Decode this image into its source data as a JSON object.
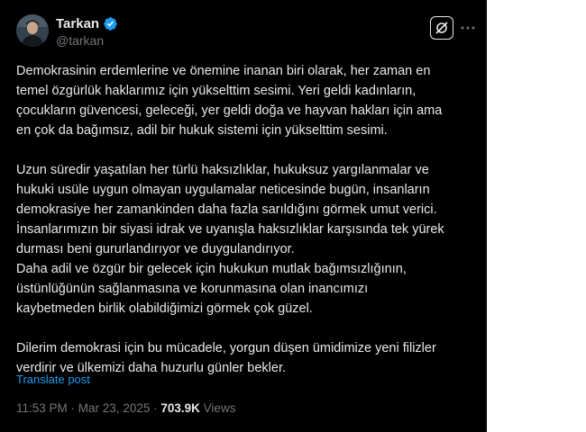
{
  "author": {
    "display_name": "Tarkan",
    "handle": "@tarkan",
    "verified": true,
    "verified_color": "#1d9bf0",
    "avatar_icon": "avatar-photo"
  },
  "actions": {
    "grok_icon": "grok-icon",
    "more_icon": "more-dots-icon"
  },
  "tweet": {
    "paragraphs": [
      {
        "lines": [
          "Demokrasinin erdemlerine ve önemine inanan biri olarak, her zaman en",
          "temel özgürlük haklarımız için yükselttim sesimi. Yeri geldi kadınların,",
          "çocukların güvencesi, geleceği, yer geldi doğa ve hayvan hakları için ama",
          "en çok da bağımsız, adil bir hukuk sistemi için  yükselttim sesimi."
        ]
      },
      {
        "lines": [
          "Uzun süredir yaşatılan her türlü haksızlıklar, hukuksuz yargılanmalar ve",
          "hukuki usüle uygun olmayan uygulamalar neticesinde bugün,  insanların",
          "demokrasiye her zamankinden daha fazla sarıldığını görmek umut verici.",
          "İnsanlarımızın bir siyasi idrak ve uyanışla haksızlıklar karşısında tek yürek",
          "durması beni gururlandırıyor ve duygulandırıyor.",
          "Daha adil ve özgür bir gelecek için hukukun mutlak bağımsızlığının,",
          "üstünlüğünün sağlanmasına ve korunmasına olan inancımızı",
          "kaybetmeden birlik olabildiğimizi görmek çok güzel."
        ]
      },
      {
        "lines": [
          "Dilerim demokrasi için bu mücadele, yorgun düşen ümidimize yeni filizler",
          "verdirir ve ülkemizi daha huzurlu günler bekler."
        ]
      }
    ],
    "translate_label": "Translate post"
  },
  "meta": {
    "time": "11:53 PM",
    "separator": " · ",
    "date": "Mar 23, 2025",
    "views_count": "703.9K",
    "views_label": "Views"
  },
  "colors": {
    "background": "#000000",
    "text": "#e7e9ea",
    "secondary": "#71767b",
    "link": "#1d9bf0"
  }
}
